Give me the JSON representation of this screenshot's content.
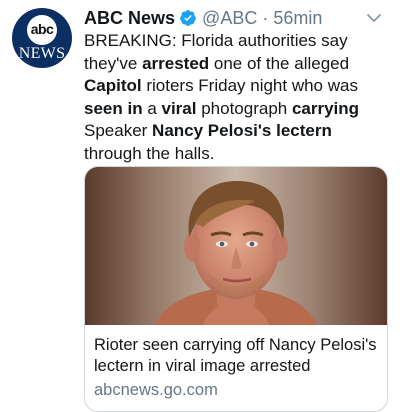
{
  "tweet": {
    "avatar": {
      "logo_text": "abc",
      "news_text": "NEWS"
    },
    "author": "ABC News",
    "handle": "@ABC",
    "separator": "·",
    "time": "56min",
    "text_segments": [
      {
        "text": "BREAKING: Florida authorities say they've ",
        "bold": false
      },
      {
        "text": "arrested",
        "bold": true
      },
      {
        "text": " one of the alleged ",
        "bold": false
      },
      {
        "text": "Capitol",
        "bold": true
      },
      {
        "text": " rioters Friday night who was ",
        "bold": false
      },
      {
        "text": "seen in",
        "bold": true
      },
      {
        "text": " a ",
        "bold": false
      },
      {
        "text": "viral",
        "bold": true
      },
      {
        "text": " photograph ",
        "bold": false
      },
      {
        "text": "carrying",
        "bold": true
      },
      {
        "text": " Speaker ",
        "bold": false
      },
      {
        "text": "Nancy Pelosi's lectern",
        "bold": true
      },
      {
        "text": " through the halls.",
        "bold": false
      }
    ]
  },
  "card": {
    "title": "Rioter seen carrying off Nancy Pelosi's lectern in viral image arrested",
    "domain": "abcnews.go.com"
  },
  "colors": {
    "verified": "#1da1f2",
    "muted_text": "#657786",
    "avatar_bg": "#0c2f63",
    "card_border": "#ccd6dd"
  }
}
